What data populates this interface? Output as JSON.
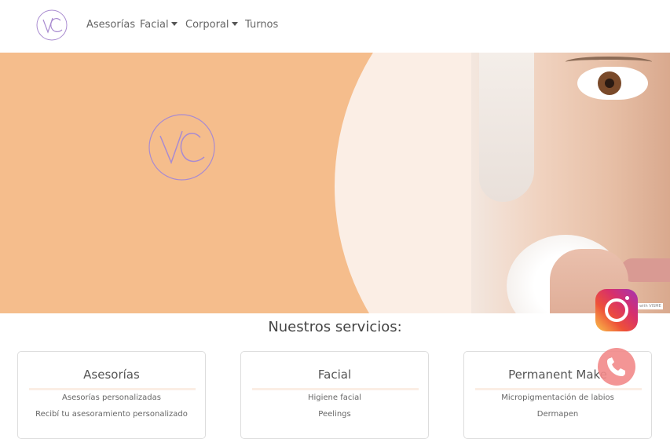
{
  "nav": {
    "logo_text": "VC",
    "items": [
      {
        "label": "Asesorías",
        "dropdown": false
      },
      {
        "label": "Facial",
        "dropdown": true
      },
      {
        "label": "Corporal",
        "dropdown": true
      },
      {
        "label": "Turnos",
        "dropdown": false
      }
    ]
  },
  "hero": {
    "logo_text": "VC",
    "watermark": "with VISME"
  },
  "services": {
    "title": "Nuestros servicios:",
    "cards": [
      {
        "title": "Asesorías",
        "items": [
          "Asesorías personalizadas",
          "Recibí tu asesoramiento personalizado"
        ]
      },
      {
        "title": "Facial",
        "items": [
          "Higiene facial",
          "Peelings"
        ]
      },
      {
        "title": "Permanent Make",
        "items": [
          "Micropigmentación de labios",
          "Dermapen"
        ]
      }
    ]
  },
  "floating": {
    "instagram_icon": "instagram-icon",
    "whatsapp_icon": "phone-icon"
  },
  "colors": {
    "hero_bg": "#f5bd8c",
    "hero_circle": "#fbeee5",
    "logo_stroke": "#a98bd0",
    "card_rule": "#fbeee5"
  }
}
